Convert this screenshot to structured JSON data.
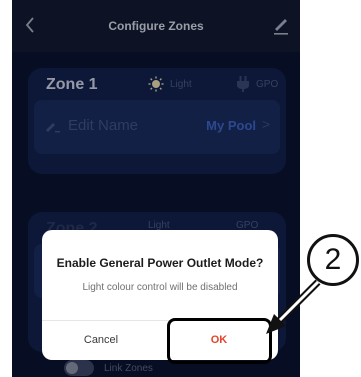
{
  "header": {
    "title": "Configure Zones",
    "back_icon": "chevron-left-icon",
    "edit_icon": "pencil-icon"
  },
  "zone1": {
    "title": "Zone 1",
    "light_label": "Light",
    "gpo_label": "GPO",
    "name_placeholder": "Edit Name",
    "name_value": "My Pool",
    "chevron": ">"
  },
  "zone2": {
    "title": "Zone 2",
    "light_label": "Light",
    "gpo_label": "GPO"
  },
  "link_zones": {
    "label": "Link Zones",
    "enabled": false
  },
  "dialog": {
    "title": "Enable General Power Outlet Mode?",
    "message": "Light colour control will be disabled",
    "cancel_label": "Cancel",
    "ok_label": "OK"
  },
  "annotation": {
    "number": "2"
  },
  "colors": {
    "background": "#0a1330",
    "card": "#122250",
    "accent": "#3d64c8",
    "ok": "#e4452a",
    "dialog_bg": "#ffffff"
  }
}
